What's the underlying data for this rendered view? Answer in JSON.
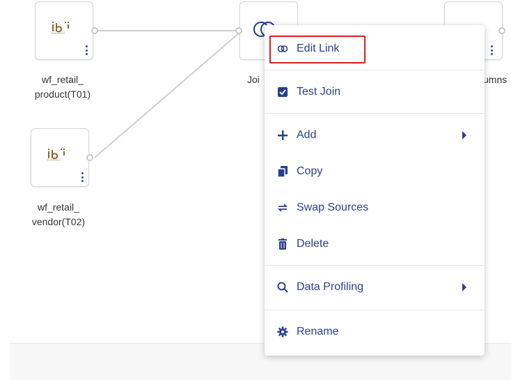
{
  "canvas": {
    "nodes": [
      {
        "id": "t01",
        "label_line1": "wf_retail_",
        "label_line2": "product(T01)"
      },
      {
        "id": "t02",
        "label_line1": "wf_retail_",
        "label_line2": "vendor(T02)"
      },
      {
        "id": "join",
        "label": "Joi"
      },
      {
        "id": "columns",
        "label": "umns"
      }
    ]
  },
  "context_menu": {
    "items": [
      {
        "label": "Edit Link",
        "icon": "link-icon",
        "highlighted": true
      },
      {
        "label": "Test Join",
        "icon": "checkbox-icon"
      },
      {
        "label": "Add",
        "icon": "plus-icon",
        "submenu": true
      },
      {
        "label": "Copy",
        "icon": "copy-icon"
      },
      {
        "label": "Swap Sources",
        "icon": "swap-icon"
      },
      {
        "label": "Delete",
        "icon": "trash-icon"
      },
      {
        "label": "Data Profiling",
        "icon": "search-icon",
        "submenu": true
      },
      {
        "label": "Rename",
        "icon": "gear-icon"
      }
    ]
  },
  "colors": {
    "menu_text": "#2a3f8f",
    "highlight_border": "#e02424",
    "connector": "#cfcfd3"
  }
}
